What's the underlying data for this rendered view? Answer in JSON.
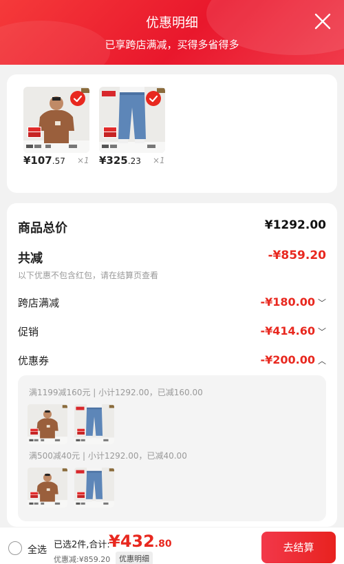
{
  "header": {
    "title": "优惠明细",
    "subtitle": "已享跨店满减，买得多省得多"
  },
  "products": [
    {
      "price_int": "¥107",
      "price_cents": ".57",
      "qty": "×1"
    },
    {
      "price_int": "¥325",
      "price_cents": ".23",
      "qty": "×1"
    }
  ],
  "summary": {
    "total_label": "商品总价",
    "total_value": "¥1292.00",
    "reduce_label": "共减",
    "reduce_value": "-¥859.20",
    "note": "以下优惠不包含红包，请在结算页查看",
    "cross_store_label": "跨店满减",
    "cross_store_value": "-¥180.00",
    "promo_label": "促销",
    "promo_value": "-¥414.60",
    "coupon_label": "优惠券",
    "coupon_value": "-¥200.00"
  },
  "coupons": [
    {
      "line": "满1199减160元 | 小计1292.00，已减160.00"
    },
    {
      "line": "满500减40元 | 小计1292.00，已减40.00"
    }
  ],
  "footer": {
    "select_all": "全选",
    "summary_text": "已选2件,合计:",
    "total_int": "¥432",
    "total_cents": ".80",
    "discount_text": "优惠减:¥859.20",
    "detail_tag": "优惠明细",
    "checkout": "去结算"
  },
  "colors": {
    "accent": "#e8281f",
    "header_bg": "#ee1f30"
  }
}
